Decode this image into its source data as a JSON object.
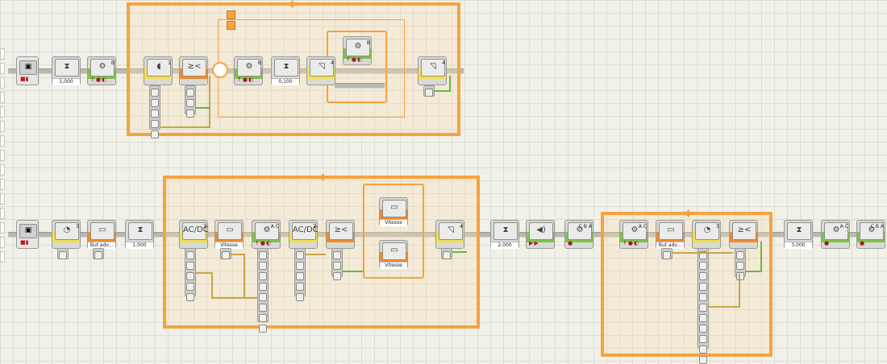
{
  "app": {
    "title": ""
  },
  "colors": {
    "loop_orange": "#f5a340",
    "motor_green": "#7fc24a",
    "sensor_yellow": "#f4e04d",
    "data_orange": "#f28a2a",
    "wire_yellow": "#c7a64a",
    "wire_green": "#6bb640"
  },
  "icons": {
    "start": "start-icon",
    "wait": "hourglass-icon",
    "motor": "gear-icon",
    "sound": "speaker-icon",
    "compare": "compare-icon",
    "display": "display-icon",
    "case": "briefcase-icon",
    "compass": "compass-icon"
  },
  "sequence1": {
    "start": {
      "icon": "▣"
    },
    "wait": {
      "label": "1,000"
    },
    "motor": {
      "port": "B"
    },
    "sensor": {
      "port": "1"
    },
    "compare": {
      "icon": "≥<"
    },
    "inner_motor": {
      "port": "B"
    },
    "inner_wait": {
      "label": "0,100"
    },
    "cmp_port": "4",
    "switch_motor": {
      "port": "B"
    },
    "logic": {
      "port": "4"
    }
  },
  "sequence2": {
    "start": {
      "icon": "▣"
    },
    "compass": {
      "port": "3"
    },
    "case": {
      "label": "But adv..."
    },
    "wait": {
      "label": "1,000"
    },
    "acdc1": {
      "label": "AC/DC",
      "port": "2"
    },
    "case_vitesse": {
      "label": "Vitesse"
    },
    "motor": {
      "port": "A C"
    },
    "acdc2": {
      "label": "AC/DC",
      "port": "2"
    },
    "compare": {
      "icon": "≥<"
    },
    "switch_true": {
      "label": "Vitesse"
    },
    "switch_false": {
      "label": "Vitesse"
    },
    "logic": {
      "port": "4"
    },
    "wait2": {
      "label": "2,000"
    },
    "sound": {
      "icon": "◀)"
    },
    "motor2": {
      "port": "C B A"
    },
    "loop_motor": {
      "port": "A C"
    },
    "loop_case": {
      "label": "But adv..."
    },
    "loop_compass": {
      "port": "3"
    },
    "loop_compare": {
      "icon": "≥<"
    },
    "wait3": {
      "label": "3,000"
    },
    "motor3": {
      "port": "A C"
    },
    "motor4": {
      "port": "C B A"
    }
  }
}
